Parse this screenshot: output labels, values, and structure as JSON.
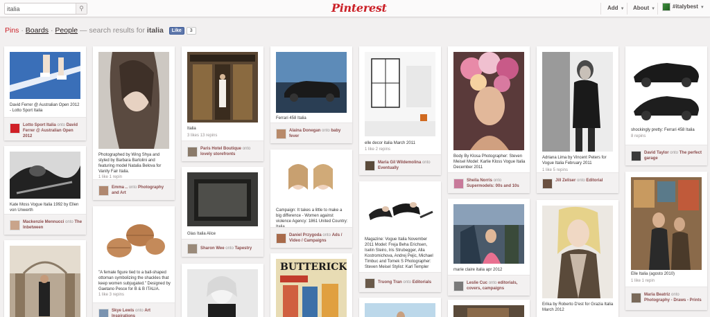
{
  "header": {
    "search_value": "italia",
    "logo_text": "Pinterest",
    "nav": {
      "add": "Add",
      "about": "About",
      "user": "#italybest"
    }
  },
  "results": {
    "pins": "Pins",
    "sep1": "·",
    "boards": "Boards",
    "sep2": "·",
    "people": "People",
    "text": "— search results for",
    "query": "italia",
    "like_label": "Like",
    "like_count": "3"
  },
  "pins": [
    {
      "desc": "David Ferrer @ Australian Open 2012 - Lotto Sport Italia",
      "stats": "",
      "user": "Lotto Sport Italia",
      "onto": "onto",
      "board": "David Ferrer @ Australian Open 2012"
    },
    {
      "desc": "Kate Moss Vogue Italia 1992 by Ellen von Unwerth",
      "stats": "",
      "user": "Mackenzie Mennucci",
      "onto": "onto",
      "board": "The Inbetween"
    },
    {
      "desc": "",
      "stats": "",
      "user": "",
      "onto": "",
      "board": ""
    },
    {
      "desc": "Photographed by Wing Shya and styled by Barbara Bartolini and featuring model Natalia Belova for Vanity Fair Italia.",
      "stats": "1 like  1 repin",
      "user": "Emma ..",
      "onto": "onto",
      "board": "Photography and Art"
    },
    {
      "desc": "\"A female figure tied to a ball-shaped ottoman symbolizing the shackles that keep women subjugated.\" Designed by Gaetano Pesce for B & B ITALIA.",
      "stats": "1 like  3 repins",
      "user": "Skye Lewis",
      "onto": "onto",
      "board": "Art Inspirations"
    },
    {
      "desc": "Italia",
      "stats": "3 likes  13 repins",
      "user": "Paris Hotel Boutique",
      "onto": "onto",
      "board": "lovely storefronts"
    },
    {
      "desc": "Glas Italia Alice",
      "stats": "",
      "user": "Sharon Wee",
      "onto": "onto",
      "board": "Tapestry"
    },
    {
      "desc": "",
      "stats": "",
      "user": "",
      "onto": "",
      "board": ""
    },
    {
      "desc": "Ferrari 458 Italia",
      "stats": "",
      "user": "Alaina Donegan",
      "onto": "onto",
      "board": "baby fever"
    },
    {
      "desc": "Campaign: It takes a little to make a big difference - Women against violence Agency: 1861 United Country: Italia",
      "stats": "",
      "user": "Daniel Przygoda",
      "onto": "onto",
      "board": "Ads / Video / Campaigns"
    },
    {
      "desc": "",
      "stats": "",
      "user": "",
      "onto": "",
      "board": ""
    },
    {
      "desc": "elle decor italia March 2011",
      "stats": "1 like  2 repins",
      "user": "Maria Gil Wildemolina",
      "onto": "onto",
      "board": "Eventually"
    },
    {
      "desc": "Magazine: Vogue Italia November 2011 Model: Freja Beha Erichsen, Iselin Steiro, Iris Strubegger, Alla Kostromichova, Andrej Pejic, Michael Timbuc and Tomek S Photographer: Steven Meisel Stylist: Karl Templer",
      "stats": "",
      "user": "Truong Tran",
      "onto": "onto",
      "board": "Editorials"
    },
    {
      "desc": "",
      "stats": "",
      "user": "",
      "onto": "",
      "board": ""
    },
    {
      "desc": "Body By Klosa Photographer: Steven Meisel Model: Karlie Kloss Vogue Italia December 2011",
      "stats": "",
      "user": "Sheila Norris",
      "onto": "onto",
      "board": "Supermodels: 00s and 10s"
    },
    {
      "desc": "marie claire italia apr 2012",
      "stats": "",
      "user": "Leslie Cuc",
      "onto": "onto",
      "board": "editorials, covers, campaigns"
    },
    {
      "desc": "",
      "stats": "",
      "user": "",
      "onto": "",
      "board": ""
    },
    {
      "desc": "Adriana Lima by Vincent Peters for Vogue Italia February 2011",
      "stats": "1 like  5 repins",
      "user": "Jill Zeliser",
      "onto": "onto",
      "board": "Editorial"
    },
    {
      "desc": "Erika by Roberto D'est for Grazia Italia March 2012",
      "stats": "",
      "user": "",
      "onto": "",
      "board": ""
    },
    {
      "desc": "shockingly pretty: Ferrari 458 Italia",
      "stats": "8 repins",
      "user": "David Taylor",
      "onto": "onto",
      "board": "The perfect garage"
    },
    {
      "desc": "Elle Italia (agosto 2010)",
      "stats": "1 like  1 repin",
      "user": "Maria Beatriz",
      "onto": "onto",
      "board": "Photography - Draws - Prints"
    }
  ],
  "colors": {
    "brand": "#cb2027",
    "background": "#f2f0f0",
    "card": "#ffffff"
  }
}
